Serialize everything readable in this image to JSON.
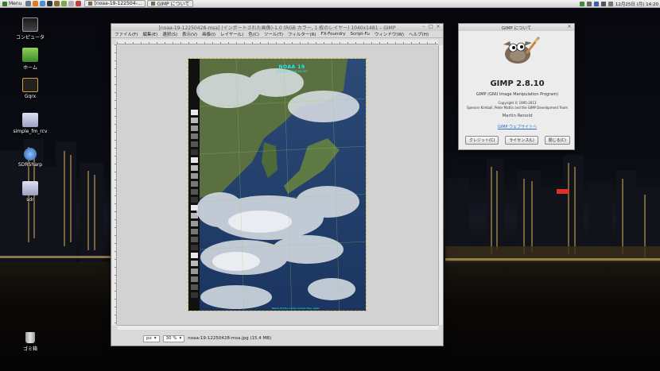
{
  "panel": {
    "menu_label": "Menu",
    "tasks": [
      {
        "label": "[noaa-19-122504-..."
      },
      {
        "label": "GIMP について"
      }
    ],
    "clock": "12月25日 (月) 14:20"
  },
  "desktop_icons": [
    {
      "label": "コンピュータ",
      "icon": "computer-icon"
    },
    {
      "label": "ホーム",
      "icon": "home-folder-icon"
    },
    {
      "label": "Gqrx",
      "icon": "gqrx-icon"
    },
    {
      "label": "simple_fm_rcv",
      "icon": "script-icon"
    },
    {
      "label": "SDRSharp",
      "icon": "sdrsharp-icon"
    },
    {
      "label": "sdr",
      "icon": "script-icon"
    }
  ],
  "trash_label": "ゴミ箱",
  "gimp": {
    "title": "[noaa-19-12250428-msa] (インポートされた画像)-1.0 (RGB カラー, 1 枚のレイヤー) 1040x1481 – GIMP",
    "menus": [
      "ファイル(F)",
      "編集(E)",
      "選択(S)",
      "表示(V)",
      "画像(I)",
      "レイヤー(L)",
      "色(C)",
      "ツール(T)",
      "フィルター(R)",
      "FX-Foundry",
      "Script-Fu",
      "ウィンドウ(W)",
      "ヘルプ(H)"
    ],
    "unit": "px",
    "zoom": "30 %",
    "status": "noaa-19-12250428-msa.jpg (15.4 MB)",
    "image": {
      "title": "NOAA 19",
      "subtitle": "2023 12 25 04:28 UTC",
      "footer": "NOAA-19 MSA enhancement  Map: Japan"
    }
  },
  "about": {
    "window_title": "GIMP について",
    "name": "GIMP 2.8.10",
    "subtitle": "GIMP (GNU Image Manipulation Program)",
    "copyright_line1": "Copyright © 1995-2013",
    "copyright_line2": "Spencer Kimball, Peter Mattis and the GIMP Development Team",
    "author": "Martin Renold",
    "link": "GIMP ウェブサイトへ",
    "buttons": {
      "credits": "クレジット(C)",
      "license": "ライセンス(L)",
      "close": "閉じる(C)"
    }
  }
}
